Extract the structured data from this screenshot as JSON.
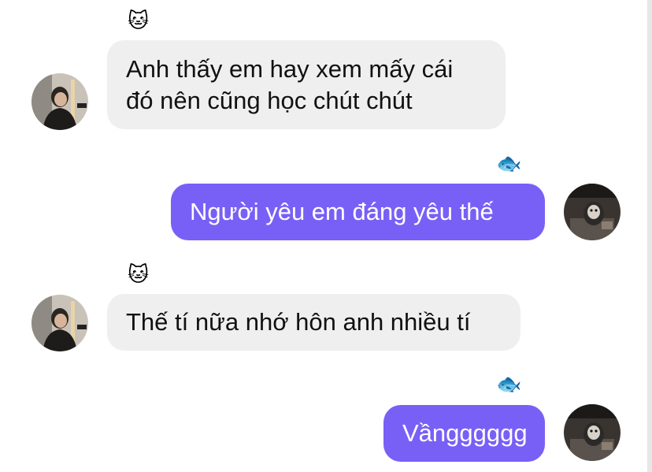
{
  "chat": {
    "accent_color": "#7860f6",
    "incoming_bubble_color": "#efefef",
    "messages": [
      {
        "sender": "other",
        "reaction_icon": "cat-face-icon",
        "reaction": "🐱",
        "text": "Anh thấy em hay xem mấy cái\nđó nên cũng học chút chút"
      },
      {
        "sender": "me",
        "reaction_icon": "fish-icon",
        "reaction": "🐟",
        "text": "Người yêu em đáng yêu thế"
      },
      {
        "sender": "other",
        "reaction_icon": "cat-face-icon",
        "reaction": "🐱",
        "text": "Thế tí nữa nhớ hôn anh nhiều tí"
      },
      {
        "sender": "me",
        "reaction_icon": "fish-icon",
        "reaction": "🐟",
        "text": "Vầngggggg"
      }
    ]
  }
}
